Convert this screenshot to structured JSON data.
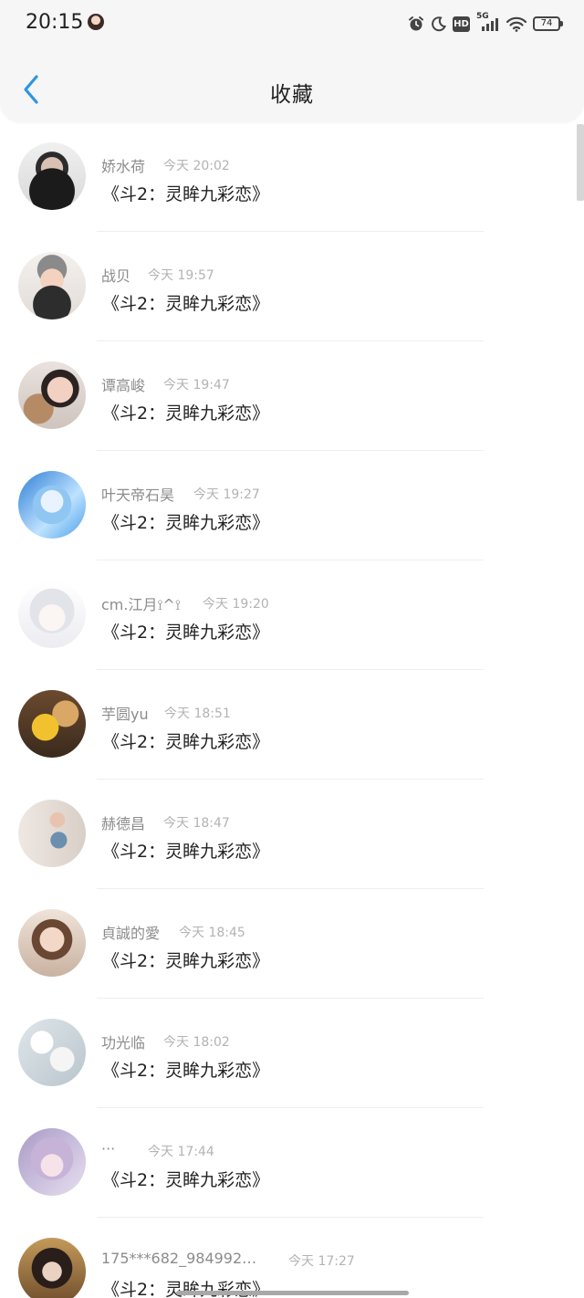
{
  "status_bar": {
    "time": "20:15",
    "icons": [
      "alarm-icon",
      "moon-icon",
      "hd-icon",
      "5g-signal-icon",
      "wifi-icon",
      "battery-icon"
    ],
    "hd_label": "HD",
    "network_label": "5G",
    "battery_level": "74"
  },
  "header": {
    "back_icon": "chevron-left-icon",
    "title": "收藏",
    "accent_color": "#2f95e0"
  },
  "favorites": [
    {
      "user": "娇水荷",
      "time": "今天 20:02",
      "title": "《斗2：灵眸九彩恋》"
    },
    {
      "user": "战贝",
      "time": "今天 19:57",
      "title": "《斗2：灵眸九彩恋》"
    },
    {
      "user": "谭高峻",
      "time": "今天 19:47",
      "title": "《斗2：灵眸九彩恋》"
    },
    {
      "user": "叶天帝石昊",
      "time": "今天 19:27",
      "title": "《斗2：灵眸九彩恋》"
    },
    {
      "user": "cm.江月⟟^⟟",
      "time": "今天 19:20",
      "title": "《斗2：灵眸九彩恋》"
    },
    {
      "user": "芋圆yu",
      "time": "今天 18:51",
      "title": "《斗2：灵眸九彩恋》"
    },
    {
      "user": "赫德昌",
      "time": "今天 18:47",
      "title": "《斗2：灵眸九彩恋》"
    },
    {
      "user": "貞誠的愛",
      "time": "今天 18:45",
      "title": "《斗2：灵眸九彩恋》"
    },
    {
      "user": "功光临",
      "time": "今天 18:02",
      "title": "《斗2：灵眸九彩恋》"
    },
    {
      "user": "···",
      "time": "今天 17:44",
      "title": "《斗2：灵眸九彩恋》"
    },
    {
      "user": "175***682_984992…",
      "time": "今天 17:27",
      "title": "《斗2：灵眸九彩恋》"
    }
  ]
}
